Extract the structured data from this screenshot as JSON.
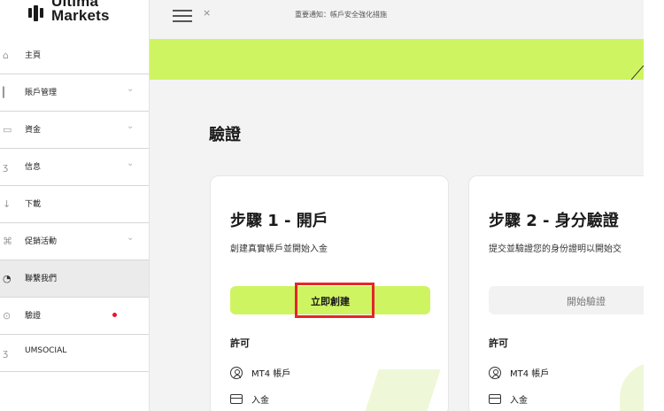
{
  "brand": {
    "line1": "Ultima",
    "line2": "Markets"
  },
  "sidebar": {
    "items": [
      {
        "label": "主頁",
        "icon": "home-icon",
        "chevron": false
      },
      {
        "label": "賬戶管理",
        "icon": "bar-chart-icon",
        "chevron": true
      },
      {
        "label": "資金",
        "icon": "wallet-icon",
        "chevron": true
      },
      {
        "label": "信息",
        "icon": "info-icon",
        "chevron": true
      },
      {
        "label": "下載",
        "icon": "download-icon",
        "chevron": false
      },
      {
        "label": "促銷活動",
        "icon": "gift-icon",
        "chevron": true
      },
      {
        "label": "聯繫我們",
        "icon": "contact-icon",
        "chevron": false,
        "active": true
      },
      {
        "label": "驗證",
        "icon": "verify-icon",
        "chevron": false,
        "dot": true
      },
      {
        "label": "UMSOCIAL",
        "icon": "social-icon",
        "chevron": false
      }
    ]
  },
  "topbar": {
    "notice": "重要通知：帳戶安全強化措施"
  },
  "page": {
    "title": "驗證"
  },
  "cards": [
    {
      "title": "步驟 1 - 開戶",
      "description": "創建真實帳戶並開始入金",
      "button": "立即創建",
      "section": "許可",
      "permissions": [
        "MT4 帳戶",
        "入金"
      ]
    },
    {
      "title": "步驟 2 - 身分驗證",
      "description": "提交並驗證您的身份證明以開始交",
      "button": "開始驗證",
      "section": "許可",
      "permissions": [
        "MT4 帳戶",
        "入金"
      ]
    }
  ],
  "colors": {
    "accent": "#cff462",
    "highlight": "#e5252a",
    "alert_dot": "#e6162f"
  }
}
